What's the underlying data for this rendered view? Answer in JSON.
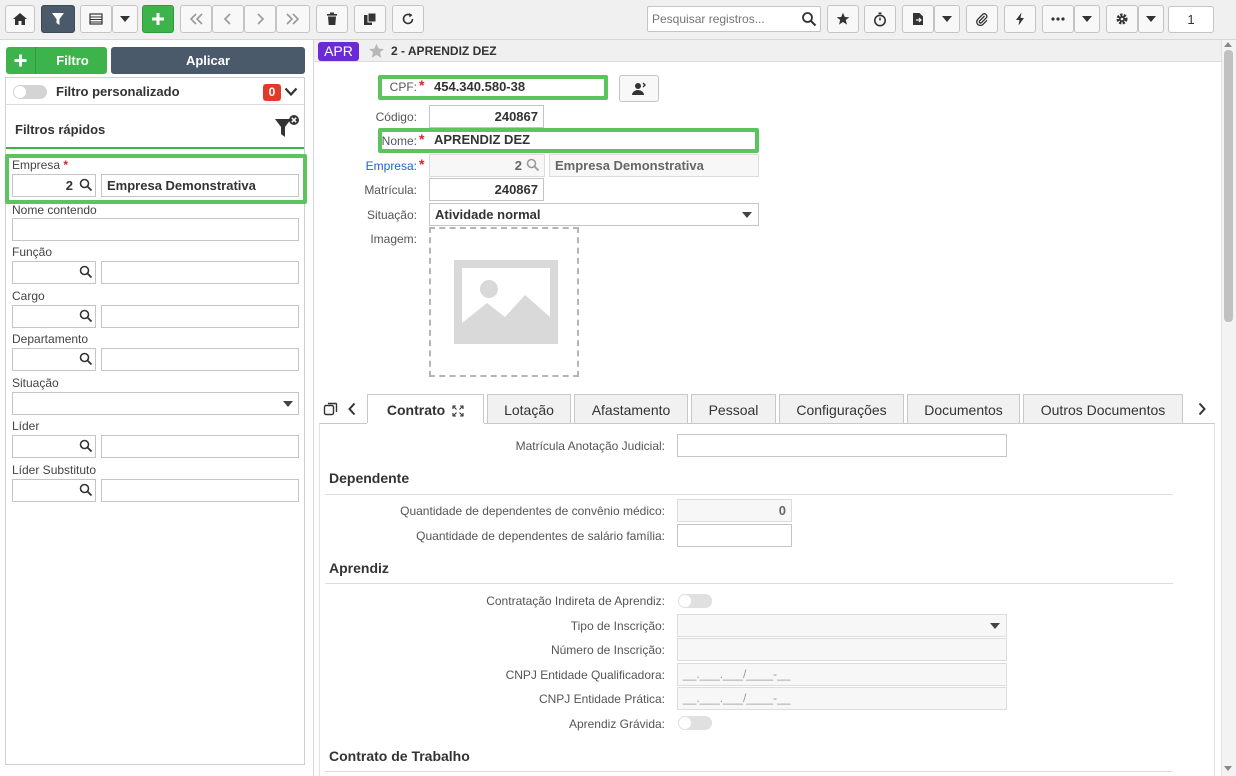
{
  "toolbar": {
    "search_placeholder": "Pesquisar registros...",
    "page_number": "1"
  },
  "filter_panel": {
    "add_filter_label": "Filtro",
    "apply_label": "Aplicar",
    "custom_filter_label": "Filtro personalizado",
    "custom_filter_count": "0",
    "quick_filters_title": "Filtros rápidos",
    "required_mark": "*",
    "empresa_label": "Empresa",
    "empresa_code": "2",
    "empresa_name": "Empresa Demonstrativa",
    "nome_contendo_label": "Nome contendo",
    "funcao_label": "Função",
    "cargo_label": "Cargo",
    "departamento_label": "Departamento",
    "situacao_label": "Situação",
    "lider_label": "Líder",
    "lider_substituto_label": "Líder Substituto"
  },
  "record": {
    "badge": "APR",
    "title": "2 - APRENDIZ DEZ",
    "cpf_label": "CPF:",
    "cpf_value": "454.340.580-38",
    "codigo_label": "Código:",
    "codigo_value": "240867",
    "nome_label": "Nome:",
    "nome_value": "APRENDIZ DEZ",
    "empresa_label": "Empresa:",
    "empresa_code": "2",
    "empresa_name": "Empresa Demonstrativa",
    "matricula_label": "Matrícula:",
    "matricula_value": "240867",
    "situacao_label": "Situação:",
    "situacao_value": "Atividade normal",
    "imagem_label": "Imagem:"
  },
  "tabs": [
    "Contrato",
    "Lotação",
    "Afastamento",
    "Pessoal",
    "Configurações",
    "Documentos",
    "Outros Documentos"
  ],
  "contrato": {
    "matricula_judicial_label": "Matrícula Anotação Judicial:",
    "dependente_title": "Dependente",
    "dep_convenio_label": "Quantidade de dependentes de convênio médico:",
    "dep_convenio_value": "0",
    "dep_salario_label": "Quantidade de dependentes de salário família:",
    "aprendiz_title": "Aprendiz",
    "contratacao_indireta_label": "Contratação Indireta de Aprendiz:",
    "tipo_inscricao_label": "Tipo de Inscrição:",
    "numero_inscricao_label": "Número de Inscrição:",
    "cnpj_qualificadora_label": "CNPJ Entidade Qualificadora:",
    "cnpj_qualificadora_mask": "__.___.___/____-__",
    "cnpj_pratica_label": "CNPJ Entidade Prática:",
    "cnpj_pratica_mask": "__.___.___/____-__",
    "aprendiz_gravida_label": "Aprendiz Grávida:",
    "contrato_trabalho_title": "Contrato de Trabalho"
  }
}
